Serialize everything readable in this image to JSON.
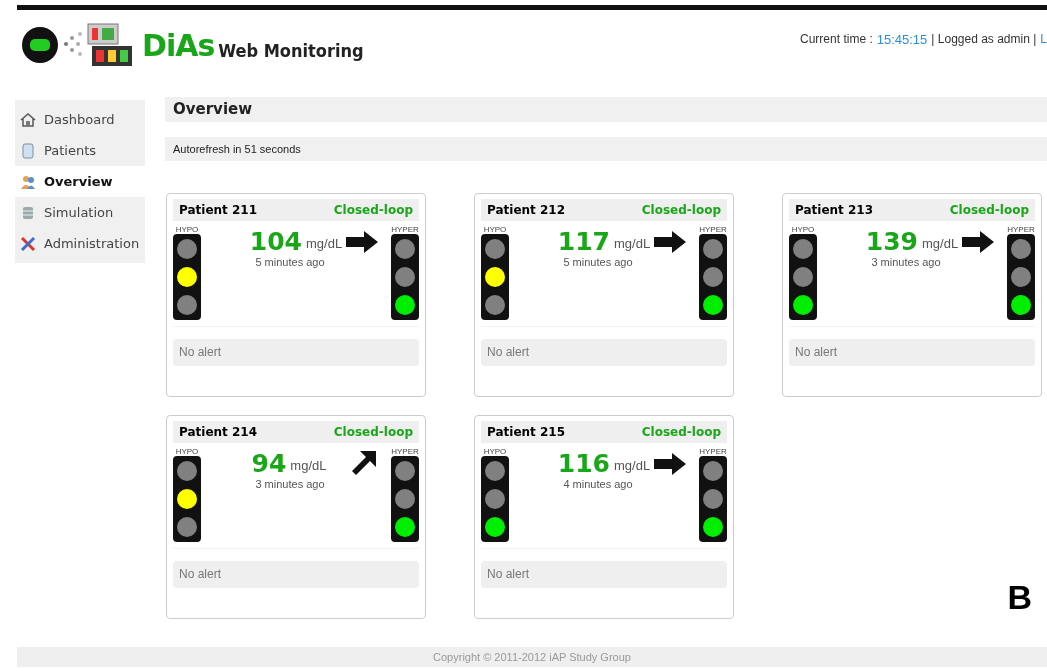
{
  "header": {
    "brand": "DiAs",
    "subtitle": "Web Monitoring",
    "time_label": "Current time :",
    "time": "15:45:15",
    "user_text": "| Logged as admin |",
    "logout_link": "L"
  },
  "sidebar": {
    "items": [
      {
        "label": "Dashboard",
        "selected": false
      },
      {
        "label": "Patients",
        "selected": false
      },
      {
        "label": "Overview",
        "selected": true
      },
      {
        "label": "Simulation",
        "selected": false
      },
      {
        "label": "Administration",
        "selected": false
      }
    ]
  },
  "page_title": "Overview",
  "autorefresh": "Autorefresh in 51 seconds",
  "patients": [
    {
      "name": "Patient 211",
      "mode": "Closed-loop",
      "value": "104",
      "unit": "mg/dL",
      "age": "5 minutes ago",
      "kind": "flat",
      "hypo": {
        "label": "HYPO",
        "lamps": [
          {
            "color": "#808080"
          },
          {
            "color": "#ffff00"
          },
          {
            "color": "#808080"
          }
        ]
      },
      "hyper": {
        "label": "HYPER",
        "lamps": [
          {
            "color": "#808080"
          },
          {
            "color": "#808080"
          },
          {
            "color": "#00ee00"
          }
        ]
      },
      "alert": "No alert"
    },
    {
      "name": "Patient 212",
      "mode": "Closed-loop",
      "value": "117",
      "unit": "mg/dL",
      "age": "5 minutes ago",
      "kind": "flat",
      "hypo": {
        "label": "HYPO",
        "lamps": [
          {
            "color": "#808080"
          },
          {
            "color": "#ffff00"
          },
          {
            "color": "#808080"
          }
        ]
      },
      "hyper": {
        "label": "HYPER",
        "lamps": [
          {
            "color": "#808080"
          },
          {
            "color": "#808080"
          },
          {
            "color": "#00ee00"
          }
        ]
      },
      "alert": "No alert"
    },
    {
      "name": "Patient 213",
      "mode": "Closed-loop",
      "value": "139",
      "unit": "mg/dL",
      "age": "3 minutes ago",
      "kind": "flat",
      "hypo": {
        "label": "HYPO",
        "lamps": [
          {
            "color": "#808080"
          },
          {
            "color": "#808080"
          },
          {
            "color": "#00ee00"
          }
        ]
      },
      "hyper": {
        "label": "HYPER",
        "lamps": [
          {
            "color": "#808080"
          },
          {
            "color": "#808080"
          },
          {
            "color": "#00ee00"
          }
        ]
      },
      "alert": "No alert"
    },
    {
      "name": "Patient 214",
      "mode": "Closed-loop",
      "value": "94",
      "unit": "mg/dL",
      "age": "3 minutes ago",
      "kind": "up",
      "hypo": {
        "label": "HYPO",
        "lamps": [
          {
            "color": "#808080"
          },
          {
            "color": "#ffff00"
          },
          {
            "color": "#808080"
          }
        ]
      },
      "hyper": {
        "label": "HYPER",
        "lamps": [
          {
            "color": "#808080"
          },
          {
            "color": "#808080"
          },
          {
            "color": "#00ee00"
          }
        ]
      },
      "alert": "No alert"
    },
    {
      "name": "Patient 215",
      "mode": "Closed-loop",
      "value": "116",
      "unit": "mg/dL",
      "age": "4 minutes ago",
      "kind": "flat",
      "hypo": {
        "label": "HYPO",
        "lamps": [
          {
            "color": "#808080"
          },
          {
            "color": "#808080"
          },
          {
            "color": "#00ee00"
          }
        ]
      },
      "hyper": {
        "label": "HYPER",
        "lamps": [
          {
            "color": "#808080"
          },
          {
            "color": "#808080"
          },
          {
            "color": "#00ee00"
          }
        ]
      },
      "alert": "No alert"
    }
  ],
  "panel_label": "B",
  "footer": "Copyright © 2011-2012 iAP Study Group"
}
